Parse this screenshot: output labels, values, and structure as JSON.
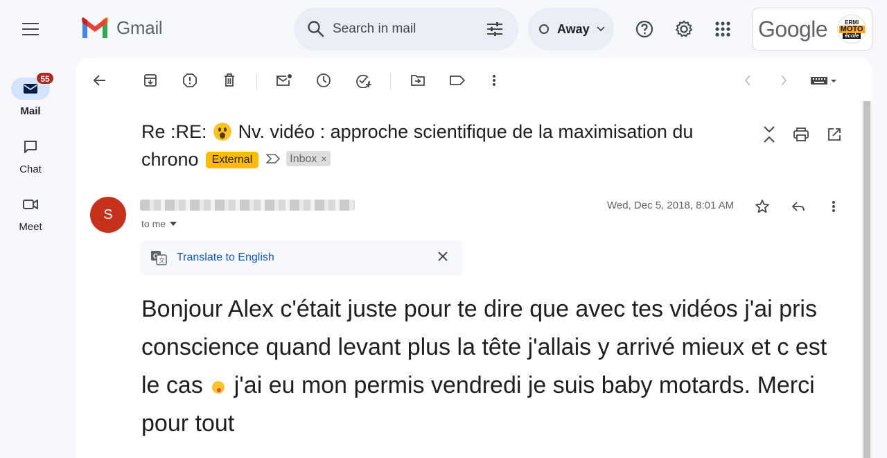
{
  "app": {
    "name": "Gmail"
  },
  "rail": {
    "items": [
      {
        "label": "Mail",
        "badge": "55",
        "icon": "mail-icon",
        "active": true
      },
      {
        "label": "Chat",
        "icon": "chat-icon",
        "active": false
      },
      {
        "label": "Meet",
        "icon": "video-icon",
        "active": false
      }
    ]
  },
  "search": {
    "placeholder": "Search in mail"
  },
  "status": {
    "label": "Away"
  },
  "account": {
    "brand": "Google",
    "avatar_text": [
      "ERMI",
      "MOTO",
      "école"
    ]
  },
  "toolbar": {
    "icons": [
      "back-arrow-icon",
      "archive-icon",
      "report-spam-icon",
      "delete-icon",
      "mark-unread-icon",
      "snooze-icon",
      "add-to-tasks-icon",
      "move-to-icon",
      "label-icon",
      "more-vert-icon",
      "newer-icon",
      "older-icon",
      "input-tools-icon"
    ]
  },
  "email": {
    "subject_prefix": "Re :RE:",
    "subject_main": "Nv. vidéo : approche scientifique de la maximisation du chrono",
    "tag_external": "External",
    "tag_inbox": "Inbox",
    "tag_inbox_close": "×",
    "sender_initial": "S",
    "recipient": "to me",
    "date": "Wed, Dec 5, 2018, 8:01 AM",
    "translate_label": "Translate to English",
    "body_part1": "Bonjour Alex c'était juste pour te dire que avec tes vidéos j'ai pris conscience quand levant plus la tête j'allais y arrivé mieux et c est le cas",
    "body_part2": "j'ai eu mon permis vendredi je suis baby motards. Merci pour tout"
  },
  "colors": {
    "badge": "#b3261e",
    "external_tag": "#fbbc04",
    "avatar": "#c5311b",
    "link": "#0b57d0",
    "rail_active": "#d3e3fd"
  }
}
